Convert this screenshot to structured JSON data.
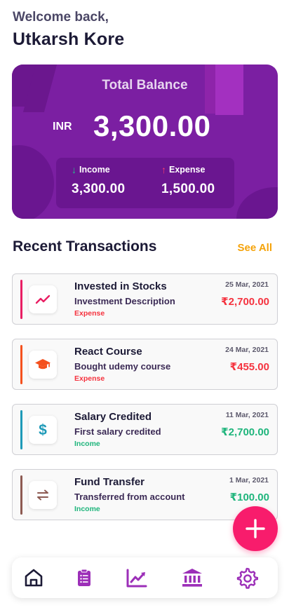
{
  "header": {
    "welcome": "Welcome back,",
    "username": "Utkarsh Kore"
  },
  "balance": {
    "title": "Total Balance",
    "currency": "INR",
    "amount": "3,300.00",
    "income_label": "Income",
    "income_value": "3,300.00",
    "expense_label": "Expense",
    "expense_value": "1,500.00"
  },
  "transactions_section": {
    "title": "Recent Transactions",
    "see_all": "See All"
  },
  "transactions": [
    {
      "title": "Invested in Stocks",
      "description": "Investment Description",
      "type": "Expense",
      "date": "25 Mar, 2021",
      "amount": "₹2,700.00",
      "icon": "trending-up-icon",
      "accent": "#e91e63"
    },
    {
      "title": "React Course",
      "description": "Bought udemy course",
      "type": "Expense",
      "date": "24 Mar, 2021",
      "amount": "₹455.00",
      "icon": "graduation-cap-icon",
      "accent": "#f4511e"
    },
    {
      "title": "Salary Credited",
      "description": "First salary credited",
      "type": "Income",
      "date": "11 Mar, 2021",
      "amount": "₹2,700.00",
      "icon": "dollar-icon",
      "accent": "#1e9ab8"
    },
    {
      "title": "Fund Transfer",
      "description": "Transferred from account",
      "type": "Income",
      "date": "1 Mar, 2021",
      "amount": "₹100.00",
      "icon": "transfer-arrows-icon",
      "accent": "#8d5a52"
    }
  ],
  "colors": {
    "card_purple": "#7b1fa2",
    "expense_red": "#f5333f",
    "income_green": "#1fb57c",
    "see_all_orange": "#f5a30a",
    "fab_pink": "#f81c6c",
    "nav_purple": "#9c2fb8"
  },
  "nav": {
    "items": [
      "home-icon",
      "clipboard-icon",
      "chart-icon",
      "bank-icon",
      "settings-gear-icon"
    ],
    "active": "home-icon"
  }
}
